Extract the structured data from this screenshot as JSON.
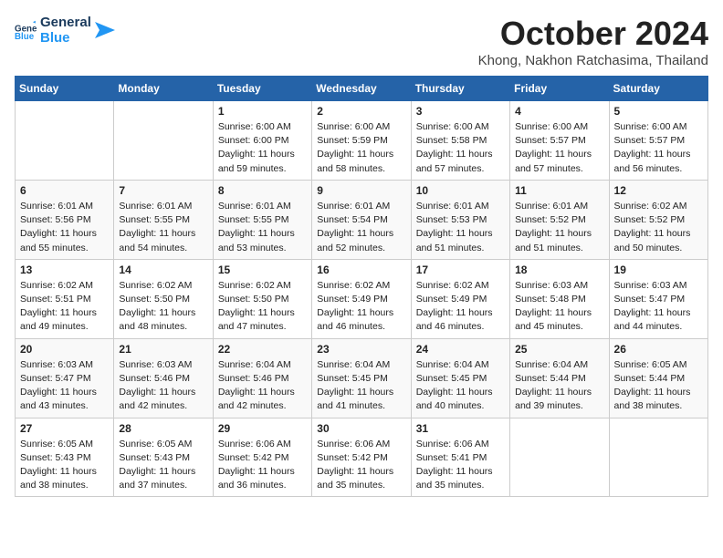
{
  "logo": {
    "line1": "General",
    "line2": "Blue"
  },
  "title": "October 2024",
  "location": "Khong, Nakhon Ratchasima, Thailand",
  "weekdays": [
    "Sunday",
    "Monday",
    "Tuesday",
    "Wednesday",
    "Thursday",
    "Friday",
    "Saturday"
  ],
  "weeks": [
    [
      {
        "day": "",
        "info": ""
      },
      {
        "day": "",
        "info": ""
      },
      {
        "day": "1",
        "info": "Sunrise: 6:00 AM\nSunset: 6:00 PM\nDaylight: 11 hours\nand 59 minutes."
      },
      {
        "day": "2",
        "info": "Sunrise: 6:00 AM\nSunset: 5:59 PM\nDaylight: 11 hours\nand 58 minutes."
      },
      {
        "day": "3",
        "info": "Sunrise: 6:00 AM\nSunset: 5:58 PM\nDaylight: 11 hours\nand 57 minutes."
      },
      {
        "day": "4",
        "info": "Sunrise: 6:00 AM\nSunset: 5:57 PM\nDaylight: 11 hours\nand 57 minutes."
      },
      {
        "day": "5",
        "info": "Sunrise: 6:00 AM\nSunset: 5:57 PM\nDaylight: 11 hours\nand 56 minutes."
      }
    ],
    [
      {
        "day": "6",
        "info": "Sunrise: 6:01 AM\nSunset: 5:56 PM\nDaylight: 11 hours\nand 55 minutes."
      },
      {
        "day": "7",
        "info": "Sunrise: 6:01 AM\nSunset: 5:55 PM\nDaylight: 11 hours\nand 54 minutes."
      },
      {
        "day": "8",
        "info": "Sunrise: 6:01 AM\nSunset: 5:55 PM\nDaylight: 11 hours\nand 53 minutes."
      },
      {
        "day": "9",
        "info": "Sunrise: 6:01 AM\nSunset: 5:54 PM\nDaylight: 11 hours\nand 52 minutes."
      },
      {
        "day": "10",
        "info": "Sunrise: 6:01 AM\nSunset: 5:53 PM\nDaylight: 11 hours\nand 51 minutes."
      },
      {
        "day": "11",
        "info": "Sunrise: 6:01 AM\nSunset: 5:52 PM\nDaylight: 11 hours\nand 51 minutes."
      },
      {
        "day": "12",
        "info": "Sunrise: 6:02 AM\nSunset: 5:52 PM\nDaylight: 11 hours\nand 50 minutes."
      }
    ],
    [
      {
        "day": "13",
        "info": "Sunrise: 6:02 AM\nSunset: 5:51 PM\nDaylight: 11 hours\nand 49 minutes."
      },
      {
        "day": "14",
        "info": "Sunrise: 6:02 AM\nSunset: 5:50 PM\nDaylight: 11 hours\nand 48 minutes."
      },
      {
        "day": "15",
        "info": "Sunrise: 6:02 AM\nSunset: 5:50 PM\nDaylight: 11 hours\nand 47 minutes."
      },
      {
        "day": "16",
        "info": "Sunrise: 6:02 AM\nSunset: 5:49 PM\nDaylight: 11 hours\nand 46 minutes."
      },
      {
        "day": "17",
        "info": "Sunrise: 6:02 AM\nSunset: 5:49 PM\nDaylight: 11 hours\nand 46 minutes."
      },
      {
        "day": "18",
        "info": "Sunrise: 6:03 AM\nSunset: 5:48 PM\nDaylight: 11 hours\nand 45 minutes."
      },
      {
        "day": "19",
        "info": "Sunrise: 6:03 AM\nSunset: 5:47 PM\nDaylight: 11 hours\nand 44 minutes."
      }
    ],
    [
      {
        "day": "20",
        "info": "Sunrise: 6:03 AM\nSunset: 5:47 PM\nDaylight: 11 hours\nand 43 minutes."
      },
      {
        "day": "21",
        "info": "Sunrise: 6:03 AM\nSunset: 5:46 PM\nDaylight: 11 hours\nand 42 minutes."
      },
      {
        "day": "22",
        "info": "Sunrise: 6:04 AM\nSunset: 5:46 PM\nDaylight: 11 hours\nand 42 minutes."
      },
      {
        "day": "23",
        "info": "Sunrise: 6:04 AM\nSunset: 5:45 PM\nDaylight: 11 hours\nand 41 minutes."
      },
      {
        "day": "24",
        "info": "Sunrise: 6:04 AM\nSunset: 5:45 PM\nDaylight: 11 hours\nand 40 minutes."
      },
      {
        "day": "25",
        "info": "Sunrise: 6:04 AM\nSunset: 5:44 PM\nDaylight: 11 hours\nand 39 minutes."
      },
      {
        "day": "26",
        "info": "Sunrise: 6:05 AM\nSunset: 5:44 PM\nDaylight: 11 hours\nand 38 minutes."
      }
    ],
    [
      {
        "day": "27",
        "info": "Sunrise: 6:05 AM\nSunset: 5:43 PM\nDaylight: 11 hours\nand 38 minutes."
      },
      {
        "day": "28",
        "info": "Sunrise: 6:05 AM\nSunset: 5:43 PM\nDaylight: 11 hours\nand 37 minutes."
      },
      {
        "day": "29",
        "info": "Sunrise: 6:06 AM\nSunset: 5:42 PM\nDaylight: 11 hours\nand 36 minutes."
      },
      {
        "day": "30",
        "info": "Sunrise: 6:06 AM\nSunset: 5:42 PM\nDaylight: 11 hours\nand 35 minutes."
      },
      {
        "day": "31",
        "info": "Sunrise: 6:06 AM\nSunset: 5:41 PM\nDaylight: 11 hours\nand 35 minutes."
      },
      {
        "day": "",
        "info": ""
      },
      {
        "day": "",
        "info": ""
      }
    ]
  ]
}
